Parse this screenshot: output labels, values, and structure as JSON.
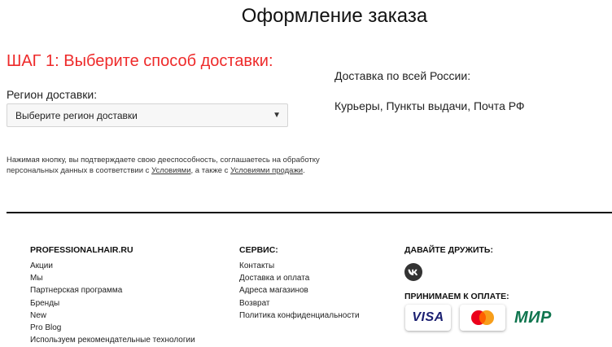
{
  "page": {
    "title": "Оформление заказа"
  },
  "step": {
    "title": "ШАГ 1: Выберите способ доставки:",
    "title_color": "#ee2a2a"
  },
  "region": {
    "label": "Регион доставки:",
    "select_value": "Выберите регион доставки",
    "caret": "▼"
  },
  "delivery": {
    "info": "Доставка по всей России:",
    "methods": "Курьеры, Пункты выдачи, Почта РФ"
  },
  "consent": {
    "text_before": "Нажимая кнопку, вы подтверждаете свою дееспособность, соглашаетесь на обработку персональных данных в соответствии с ",
    "link_terms": "Условиями",
    "text_middle": ", а также с ",
    "link_sale_terms": "Условиями продажи",
    "text_after": "."
  },
  "footer": {
    "col1": {
      "title": "PROFESSIONALHAIR.RU",
      "links": [
        "Акции",
        "Мы",
        "Партнерская программа",
        "Бренды",
        "New",
        "Pro Blog",
        "Используем рекомендательные технологии"
      ]
    },
    "col2": {
      "title": "СЕРВИС:",
      "links": [
        "Контакты",
        "Доставка и оплата",
        "Адреса магазинов",
        "Возврат",
        "Политика конфиденциальности"
      ]
    },
    "social": {
      "title": "ДАВАЙТЕ ДРУЖИТЬ:",
      "icon": "vk-icon"
    },
    "payment": {
      "title": "ПРИНИМАЕМ К ОПЛАТЕ:",
      "visa": "VISA",
      "mir": "МИР",
      "icons": [
        "visa-logo",
        "mastercard-logo",
        "mir-logo"
      ]
    }
  }
}
